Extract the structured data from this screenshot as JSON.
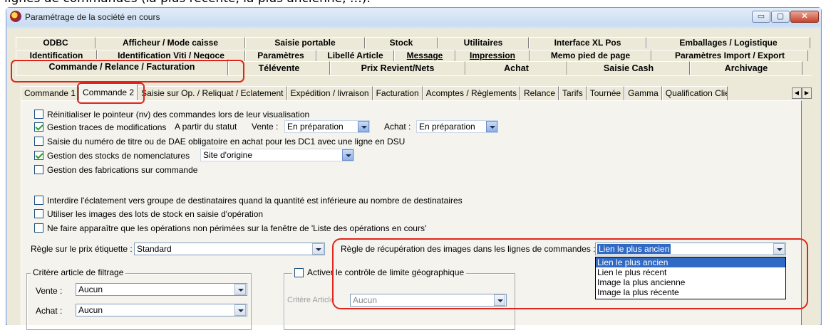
{
  "top_caption": "lignes de commandes (la plus récente, la plus ancienne, …).",
  "window": {
    "title": "Paramétrage de la société en cours",
    "buttons": {
      "minimize": "▭",
      "maximize": "▢",
      "close": "✕"
    }
  },
  "tab_rows": {
    "row1": [
      {
        "label": "ODBC"
      },
      {
        "label": "Afficheur / Mode caisse"
      },
      {
        "label": "Saisie portable"
      },
      {
        "label": "Stock"
      },
      {
        "label": "Utilitaires"
      },
      {
        "label": "Interface XL Pos"
      },
      {
        "label": "Emballages / Logistique"
      }
    ],
    "row2": [
      {
        "label": "Identification"
      },
      {
        "label": "Identification Viti / Negoce"
      },
      {
        "label": "Paramètres"
      },
      {
        "label": "Libellé Article"
      },
      {
        "label": "Message"
      },
      {
        "label": "Impression"
      },
      {
        "label": "Memo pied de page"
      },
      {
        "label": "Paramètres Import / Export"
      }
    ],
    "row3": [
      {
        "label": "Commande / Relance / Facturation"
      },
      {
        "label": "Télévente"
      },
      {
        "label": "Prix Revient/Nets"
      },
      {
        "label": "Achat"
      },
      {
        "label": "Saisie Cash"
      },
      {
        "label": "Archivage"
      }
    ]
  },
  "inner_tabs": [
    {
      "label": "Commande 1"
    },
    {
      "label": "Commande 2"
    },
    {
      "label": "Saisie sur Op. / Reliquat / Eclatement"
    },
    {
      "label": "Expédition / livraison"
    },
    {
      "label": "Facturation"
    },
    {
      "label": "Acomptes / Règlements"
    },
    {
      "label": "Relance"
    },
    {
      "label": "Tarifs"
    },
    {
      "label": "Tournée"
    },
    {
      "label": "Gamma"
    },
    {
      "label": "Qualification Client /"
    }
  ],
  "checkboxes": {
    "reinit": {
      "label": "Réinitialiser le pointeur (nv) des commandes lors de leur visualisation",
      "checked": false
    },
    "traces": {
      "label": "Gestion traces de modifications",
      "checked": true
    },
    "saisie_titre": {
      "label": "Saisie du numéro de titre ou de DAE obligatoire en achat pour les DC1 avec une ligne en DSU",
      "checked": false
    },
    "stocks_nomenclatures": {
      "label": "Gestion des stocks de nomenclatures",
      "checked": true
    },
    "fabrications": {
      "label": "Gestion des fabrications sur commande",
      "checked": false
    },
    "interdire_eclatement": {
      "label": "Interdire l'éclatement vers groupe de destinataires quand la quantité est inférieure au nombre de destinataires",
      "checked": false
    },
    "images_lots": {
      "label": "Utiliser les images des lots de stock en saisie d'opération",
      "checked": false
    },
    "operations_non_perimees": {
      "label": "Ne faire apparaître que les opérations non périmées sur la fenêtre de 'Liste des opérations en cours'",
      "checked": false
    },
    "limite_geo": {
      "label": "Activer le contrôle de limite géographique",
      "checked": false
    }
  },
  "traces_row": {
    "a_partir": "A partir du statut",
    "vente_label": "Vente :",
    "vente_value": "En préparation",
    "achat_label": "Achat :",
    "achat_value": "En préparation"
  },
  "stocks_nomenclature_value": "Site d'origine",
  "prix_etiquette": {
    "label": "Règle sur le prix étiquette :",
    "value": "Standard"
  },
  "recuperation_images": {
    "label": "Règle de récupération des images dans les lignes de commandes :",
    "value": "Lien le plus ancien",
    "options": [
      "Lien le plus ancien",
      "Lien le plus récent",
      "Image la plus ancienne",
      "Image la plus récente"
    ],
    "selected_index": 0
  },
  "filtrage": {
    "title": "Critère article de filtrage",
    "vente_label": "Vente :",
    "vente_value": "Aucun",
    "achat_label": "Achat :",
    "achat_value": "Aucun"
  },
  "geo": {
    "critere_label": "Critère Article",
    "critere_value": "Aucun"
  },
  "colors": {
    "highlight_red": "#e0241b",
    "selection_blue": "#316ac5",
    "panel": "#f4f3ee"
  }
}
